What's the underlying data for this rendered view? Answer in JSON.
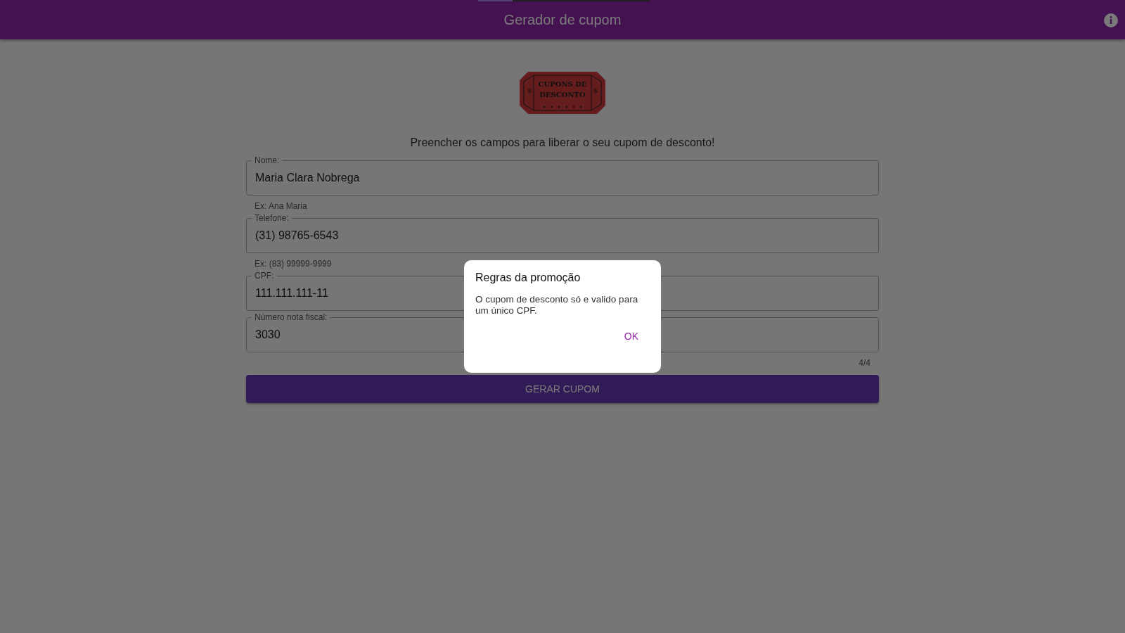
{
  "header": {
    "title": "Gerador de cupom",
    "progress": {
      "level": 0.2
    }
  },
  "logo": {
    "lines": [
      "CUPONS DE",
      "DESCONTO"
    ],
    "side_marks": [
      "$",
      "$"
    ]
  },
  "intro": "Preencher os campos para liberar o seu cupom de desconto!",
  "fields": [
    {
      "label": "Nome:",
      "value": "Maria Clara Nobrega",
      "helper": "Ex: Ana Maria"
    },
    {
      "label": "Telefone:",
      "value": "(31) 98765-6543",
      "helper": "Ex: (83) 99999-9999"
    },
    {
      "label": "CPF:",
      "value": "111.111.111-11"
    },
    {
      "label": "Número nota fiscal:",
      "value": "3030",
      "counter": "4/4"
    }
  ],
  "submit_button": "GERAR CUPOM",
  "dialog": {
    "title": "Regras da promoção",
    "message": "O cupom de desconto só e valido para um único CPF.",
    "button": "OK"
  }
}
